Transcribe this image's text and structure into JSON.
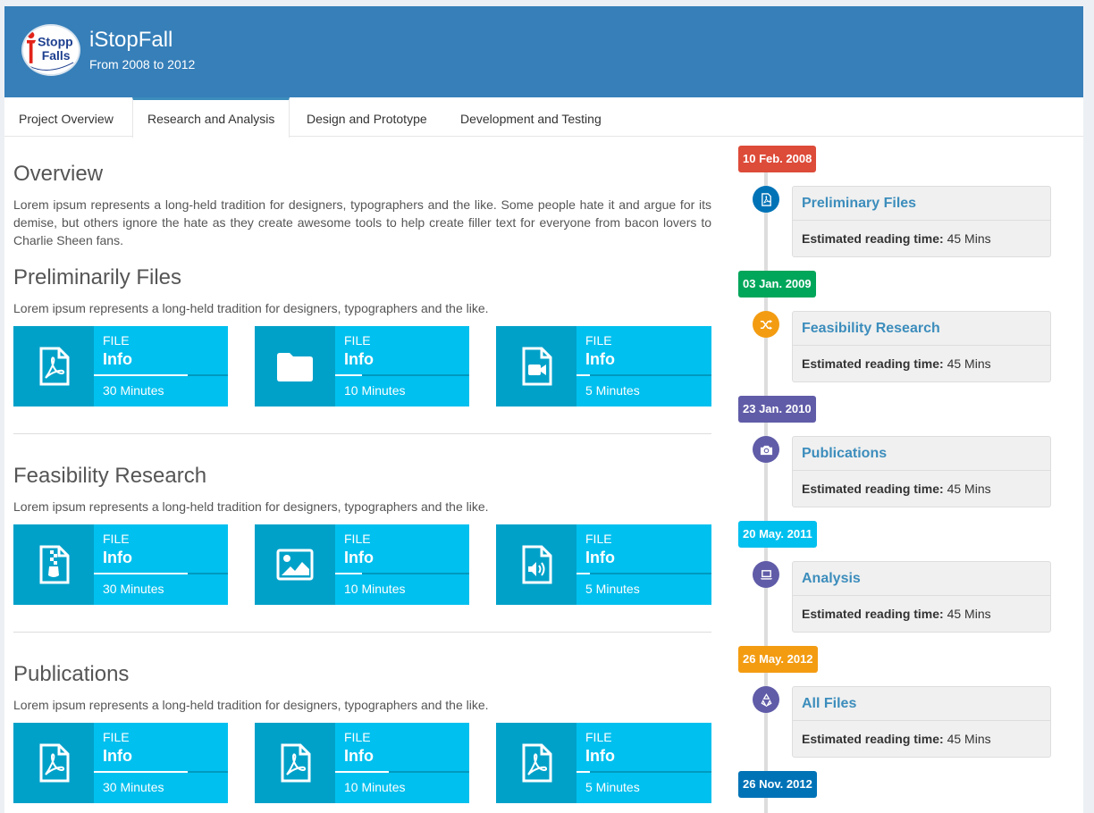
{
  "header": {
    "title": "iStopFall",
    "subtitle": "From 2008 to 2012",
    "logo_text_1": "Stopp",
    "logo_text_2": "Falls",
    "logo_tagline": "iStoppFalls - Exercise-based fall prevention"
  },
  "tabs": [
    {
      "label": "Project Overview",
      "active": false
    },
    {
      "label": "Research and Analysis",
      "active": true
    },
    {
      "label": "Design and Prototype",
      "active": false
    },
    {
      "label": "Development and Testing",
      "active": false
    }
  ],
  "overview": {
    "title": "Overview",
    "text": "Lorem ipsum represents a long-held tradition for designers, typographers and the like. Some people hate it and argue for its demise, but others ignore the hate as they create awesome tools to help create filler text for everyone from bacon lovers to Charlie Sheen fans."
  },
  "sections": [
    {
      "title": "Preliminarily Files",
      "text": "Lorem ipsum represents a long-held tradition for designers, typographers and the like.",
      "boxes": [
        {
          "icon": "file-pdf-icon",
          "label": "FILE",
          "value": "Info",
          "progress": 0.7,
          "duration": "30 Minutes"
        },
        {
          "icon": "folder-icon",
          "label": "FILE",
          "value": "Info",
          "progress": 0.2,
          "duration": "10 Minutes"
        },
        {
          "icon": "file-video-icon",
          "label": "FILE",
          "value": "Info",
          "progress": 0.1,
          "duration": "5 Minutes"
        }
      ]
    },
    {
      "title": "Feasibility Research",
      "text": "Lorem ipsum represents a long-held tradition for designers, typographers and the like.",
      "boxes": [
        {
          "icon": "file-zip-icon",
          "label": "FILE",
          "value": "Info",
          "progress": 0.7,
          "duration": "30 Minutes"
        },
        {
          "icon": "image-icon",
          "label": "FILE",
          "value": "Info",
          "progress": 0.2,
          "duration": "10 Minutes"
        },
        {
          "icon": "file-audio-icon",
          "label": "FILE",
          "value": "Info",
          "progress": 0.1,
          "duration": "5 Minutes"
        }
      ]
    },
    {
      "title": "Publications",
      "text": "Lorem ipsum represents a long-held tradition for designers, typographers and the like.",
      "boxes": [
        {
          "icon": "file-pdf-icon",
          "label": "FILE",
          "value": "Info",
          "progress": 0.7,
          "duration": "30 Minutes"
        },
        {
          "icon": "file-pdf-icon",
          "label": "FILE",
          "value": "Info",
          "progress": 0.4,
          "duration": "10 Minutes"
        },
        {
          "icon": "file-pdf-icon",
          "label": "FILE",
          "value": "Info",
          "progress": 0.1,
          "duration": "5 Minutes"
        }
      ]
    }
  ],
  "timeline": [
    {
      "date": "10 Feb. 2008",
      "date_color": "#dd4b39",
      "icon": "file-pdf-icon",
      "icon_color": "#0073b7",
      "title": "Preliminary Files",
      "meta_label": "Estimated reading time:",
      "meta_value": "45 Mins"
    },
    {
      "date": "03 Jan. 2009",
      "date_color": "#00a65a",
      "icon": "shuffle-icon",
      "icon_color": "#f39c12",
      "title": "Feasibility Research",
      "meta_label": "Estimated reading time:",
      "meta_value": "45 Mins"
    },
    {
      "date": "23 Jan. 2010",
      "date_color": "#605ca8",
      "icon": "camera-icon",
      "icon_color": "#605ca8",
      "title": "Publications",
      "meta_label": "Estimated reading time:",
      "meta_value": "45 Mins"
    },
    {
      "date": "20 May. 2011",
      "date_color": "#00c0ef",
      "icon": "laptop-icon",
      "icon_color": "#605ca8",
      "title": "Analysis",
      "meta_label": "Estimated reading time:",
      "meta_value": "45 Mins"
    },
    {
      "date": "26 May. 2012",
      "date_color": "#f39c12",
      "icon": "recycle-icon",
      "icon_color": "#605ca8",
      "title": "All Files",
      "meta_label": "Estimated reading time:",
      "meta_value": "45 Mins"
    },
    {
      "date": "26 Nov. 2012",
      "date_color": "#0073b7"
    }
  ]
}
